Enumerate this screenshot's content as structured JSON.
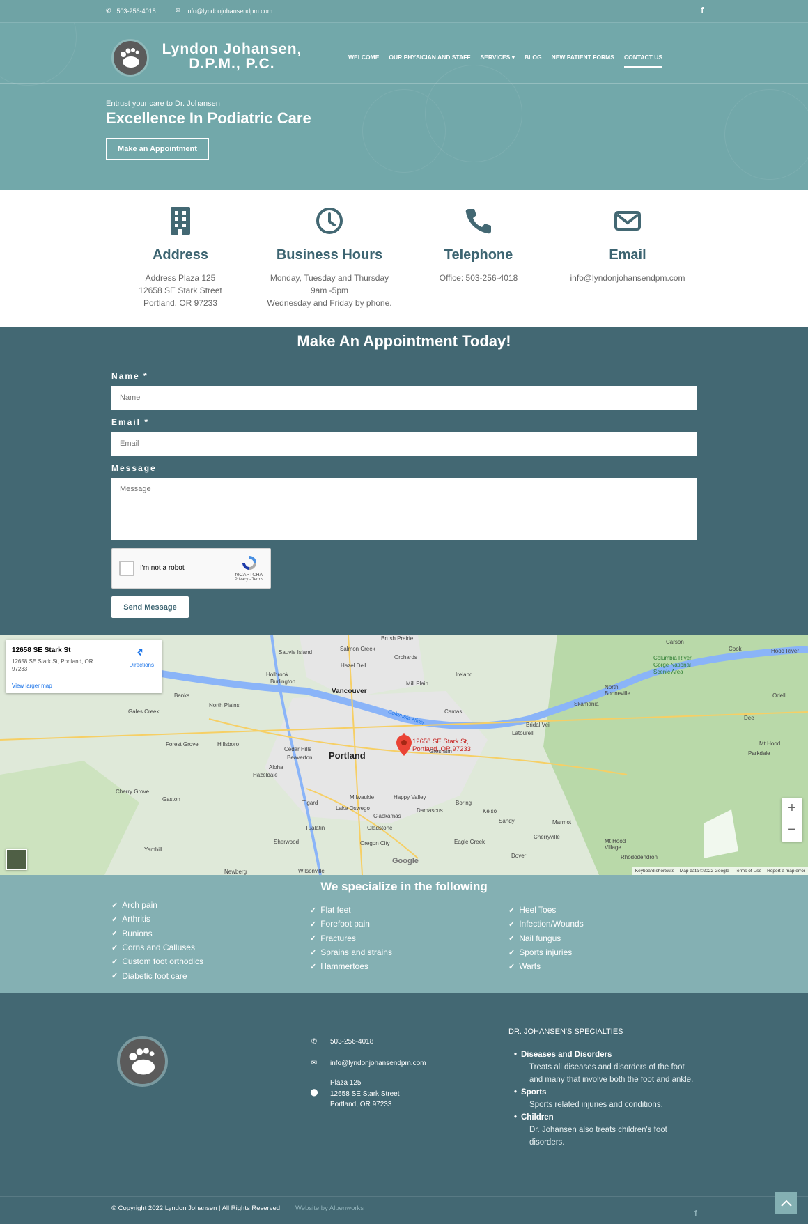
{
  "topbar": {
    "phone": "503-256-4018",
    "email": "info@lyndonjohansendpm.com"
  },
  "brand": {
    "line1": "Lyndon Johansen,",
    "line2": "D.P.M., P.C."
  },
  "nav": {
    "items": [
      "WELCOME",
      "OUR PHYSICIAN AND STAFF",
      "SERVICES",
      "BLOG",
      "NEW PATIENT FORMS",
      "CONTACT US"
    ],
    "active": "CONTACT US"
  },
  "hero": {
    "tagline": "Entrust your care to Dr. Johansen",
    "headline": "Excellence In Podiatric Care",
    "cta": "Make an Appointment"
  },
  "info": {
    "address": {
      "title": "Address",
      "lines": [
        "Address Plaza 125",
        "12658 SE Stark Street",
        "Portland, OR 97233"
      ]
    },
    "hours": {
      "title": "Business Hours",
      "lines": [
        "Monday, Tuesday and Thursday",
        "9am -5pm",
        "Wednesday and Friday by phone."
      ]
    },
    "telephone": {
      "title": "Telephone",
      "lines": [
        "Office: 503-256-4018"
      ]
    },
    "email": {
      "title": "Email",
      "lines": [
        "info@lyndonjohansendpm.com"
      ]
    }
  },
  "appointment": {
    "title": "Make An Appointment Today!",
    "name_label": "Name *",
    "name_placeholder": "Name",
    "email_label": "Email *",
    "email_placeholder": "Email",
    "message_label": "Message",
    "message_placeholder": "Message",
    "captcha_label": "I'm not a robot",
    "captcha_brand": "reCAPTCHA",
    "captcha_links": "Privacy - Terms",
    "send": "Send Message"
  },
  "map": {
    "card_name": "12658 SE Stark St",
    "card_address": "12658 SE Stark St, Portland, OR 97233",
    "directions": "Directions",
    "larger_map": "View larger map",
    "pin_line1": "12658 SE Stark St,",
    "pin_line2": "Portland, OR 97233",
    "city": "Portland",
    "places": [
      "Brush Prairie",
      "Salmon Creek",
      "Orchards",
      "Sauvie Island",
      "Hazel Dell",
      "Holbrook",
      "Burlington",
      "Mill Plain",
      "Ireland",
      "Vancouver",
      "Banks",
      "North Plains",
      "Camas",
      "Gales Creek",
      "Bridal Veil",
      "Latourell",
      "Forest Grove",
      "Hillsboro",
      "Cedar Hills",
      "Beaverton",
      "Gresham",
      "Aloha",
      "Hazeldale",
      "Cherry Grove",
      "Gaston",
      "Tigard",
      "Milwaukie",
      "Happy Valley",
      "Lake Oswego",
      "Clackamas",
      "Damascus",
      "Boring",
      "Kelso",
      "Sandy",
      "Marmot",
      "Gladstone",
      "Tualatin",
      "Sherwood",
      "Oregon City",
      "Eagle Creek",
      "Cherryville",
      "Yamhill",
      "Newberg",
      "Wilsonville",
      "Dover",
      "Mt Hood Village",
      "Rhododendron",
      "Carson",
      "Cook",
      "Hood River",
      "Columbia River Gorge National Scenic Area",
      "North Bonneville",
      "Skamania",
      "Odell",
      "Dee",
      "Mt Hood",
      "Parkdale",
      "Columbia River"
    ],
    "footer": [
      "Keyboard shortcuts",
      "Map data ©2022 Google",
      "Terms of Use",
      "Report a map error"
    ],
    "google": "Google"
  },
  "specialties": {
    "title": "We specialize in the following",
    "col1": [
      "Arch pain",
      "Arthritis",
      "Bunions",
      "Corns and Calluses",
      "Custom foot orthodics",
      "Diabetic foot care"
    ],
    "col2": [
      "Flat feet",
      "Forefoot pain",
      "Fractures",
      "Sprains and strains",
      "Hammertoes"
    ],
    "col3": [
      "Heel Toes",
      "Infection/Wounds",
      "Nail fungus",
      "Sports injuries",
      "Warts"
    ]
  },
  "footer": {
    "phone": "503-256-4018",
    "email": "info@lyndonjohansendpm.com",
    "address": [
      "Plaza 125",
      "12658 SE Stark Street",
      "Portland, OR 97233"
    ],
    "spec_title": "DR. JOHANSEN'S SPECIALTIES",
    "specs": [
      {
        "h": "Diseases and Disorders",
        "d": "Treats all diseases and disorders of the foot and many that involve both the foot and ankle."
      },
      {
        "h": "Sports",
        "d": "Sports related injuries and conditions."
      },
      {
        "h": "Children",
        "d": "Dr. Johansen also treats children's foot disorders."
      }
    ],
    "copyright": "© Copyright 2022 Lyndon Johansen | All Rights Reserved",
    "credit": "Website by Alpenworks"
  },
  "colors": {
    "teal": "#72a8aa",
    "dark_teal": "#436873",
    "light_teal": "#84b0b3",
    "heading": "#3c6471"
  }
}
